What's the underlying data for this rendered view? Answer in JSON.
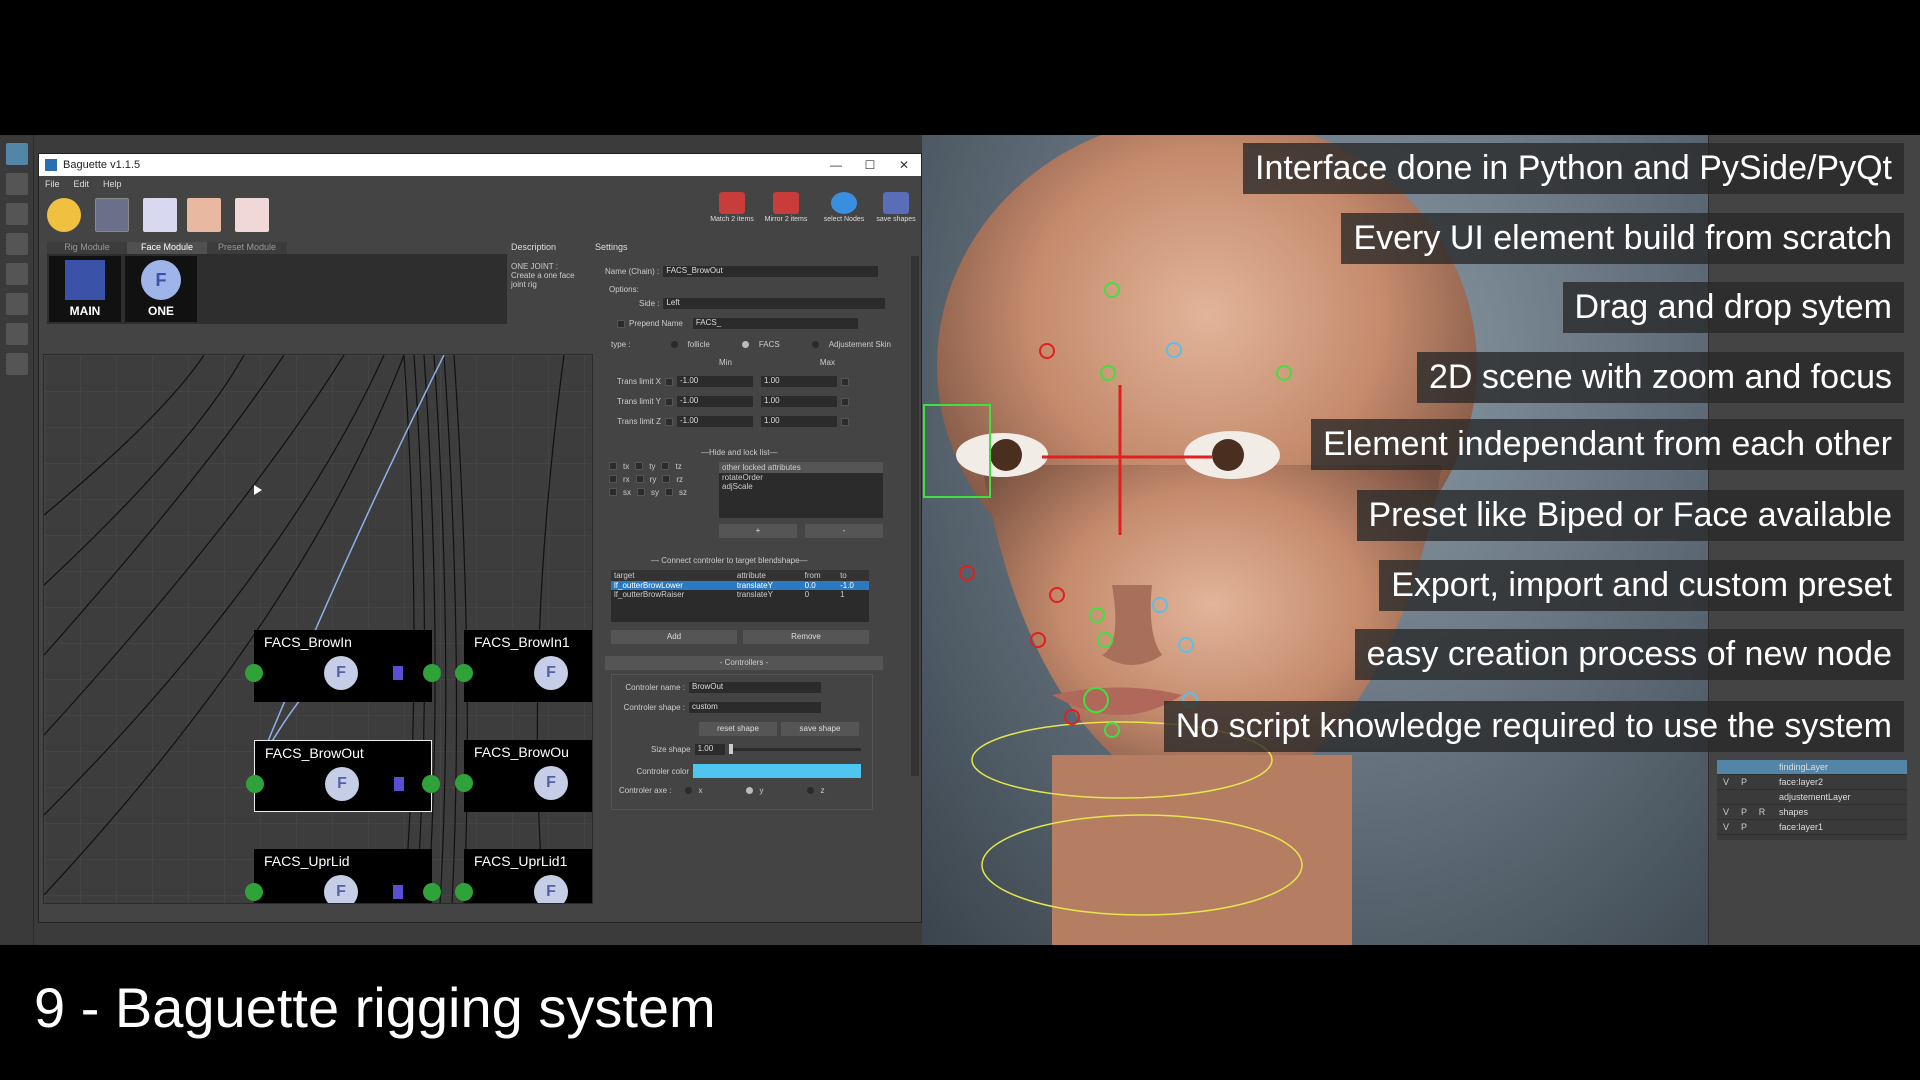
{
  "window": {
    "title": "Baguette v1.1.5",
    "min": "—",
    "max": "☐",
    "close": "✕"
  },
  "menu": [
    "File",
    "Edit",
    "Help"
  ],
  "toolbar_right": [
    {
      "label": "Match 2 items",
      "color": "#c83c3c"
    },
    {
      "label": "Mirror 2 items",
      "color": "#c83c3c"
    },
    {
      "label": "select Nodes",
      "color": "#3a8ee0"
    },
    {
      "label": "save shapes",
      "color": "#5a6db8"
    }
  ],
  "module_tabs": [
    "Rig Module",
    "Face Module",
    "Preset Module"
  ],
  "modules": [
    {
      "label": "MAIN",
      "icon": "main-module-icon"
    },
    {
      "label": "ONE",
      "icon": "f-module-icon",
      "glyph": "F"
    }
  ],
  "description": {
    "title": "Description",
    "text": "ONE JOINT :\nCreate a one face\njoint rig"
  },
  "settings": {
    "title": "Settings",
    "name_label": "Name (Chain) :",
    "name_value": "FACS_BrowOut",
    "options_label": "Options:",
    "side_label": "Side :",
    "side_value": "Left",
    "prepend_label": "Prepend Name",
    "prepend_value": "FACS_",
    "type_label": "type :",
    "type_options": [
      "follicle",
      "FACS",
      "Adjustement Skin"
    ],
    "min_label": "Min",
    "max_label": "Max",
    "limits": [
      {
        "label": "Trans limit X",
        "min": "-1.00",
        "max": "1.00"
      },
      {
        "label": "Trans limit Y",
        "min": "-1.00",
        "max": "1.00"
      },
      {
        "label": "Trans limit Z",
        "min": "-1.00",
        "max": "1.00"
      }
    ],
    "hide_lock_label": "—Hide and lock list—",
    "locked_header": "other locked attributes",
    "locked_items": [
      "rotateOrder",
      "adjScale"
    ],
    "attr_rows": [
      [
        "tx",
        "ty",
        "tz"
      ],
      [
        "rx",
        "ry",
        "rz"
      ],
      [
        "sx",
        "sy",
        "sz"
      ]
    ],
    "plus": "+",
    "minus": "-",
    "connect_label": "— Connect controler to target blendshape—",
    "bs_headers": [
      "target",
      "attribute",
      "from",
      "to"
    ],
    "bs_rows": [
      [
        "lf_outterBrowLower",
        "translateY",
        "0.0",
        "-1.0"
      ],
      [
        "lf_outterBrowRaiser",
        "translateY",
        "0",
        "1"
      ]
    ],
    "add": "Add",
    "remove": "Remove",
    "controllers_label": "- Controllers -",
    "ctrl_name_label": "Controler name :",
    "ctrl_name": "BrowOut",
    "ctrl_shape_label": "Controler shape :",
    "ctrl_shape": "custom",
    "reset_shape": "reset shape",
    "save_shape": "save shape",
    "size_label": "Size shape",
    "size_value": "1.00",
    "color_label": "Controler color",
    "ctrl_color": "#4fc6f0",
    "axe_label": "Controler axe :",
    "axes": [
      "x",
      "y",
      "z"
    ]
  },
  "nodes": [
    {
      "title": "FACS_BrowIn",
      "glyph": "F"
    },
    {
      "title": "FACS_BrowIn1",
      "glyph": "F"
    },
    {
      "title": "FACS_BrowOut",
      "glyph": "F"
    },
    {
      "title": "FACS_BrowOu",
      "glyph": "F"
    },
    {
      "title": "FACS_UprLid",
      "glyph": "F"
    },
    {
      "title": "FACS_UprLid1",
      "glyph": "F"
    }
  ],
  "overlay": [
    "Interface done in Python and PySide/PyQt",
    "Every UI element build from scratch",
    "Drag and drop sytem",
    "2D scene with zoom and focus",
    "Element independant from each other",
    "Preset like Biped or Face available",
    "Export, import and custom preset",
    "easy creation process of new node",
    "No script knowledge required to use the system"
  ],
  "layers": [
    {
      "v": "",
      "p": "",
      "r": "",
      "name": "findingLayer"
    },
    {
      "v": "V",
      "p": "P",
      "r": "",
      "name": "face:layer2"
    },
    {
      "v": "",
      "p": "",
      "r": "",
      "name": "adjustementLayer"
    },
    {
      "v": "V",
      "p": "P",
      "r": "R",
      "name": "shapes"
    },
    {
      "v": "V",
      "p": "P",
      "r": "",
      "name": "face:layer1"
    }
  ],
  "caption": "9 - Baguette rigging system"
}
